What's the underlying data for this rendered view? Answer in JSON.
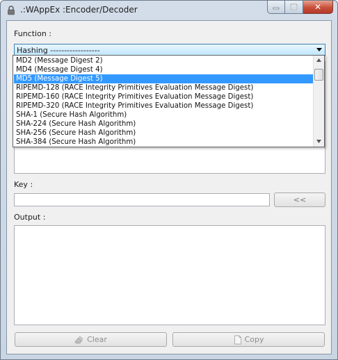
{
  "window": {
    "title": ".:WAppEx :Encoder/Decoder",
    "close_glyph": "✕"
  },
  "function": {
    "label": "Function :",
    "selected_value": "Hashing ------------------"
  },
  "dropdown": {
    "items": [
      "MD2 (Message Digest 2)",
      "MD4 (Message Digest 4)",
      "MD5 (Message Digest 5)",
      "RIPEMD-128 (RACE Integrity Primitives Evaluation Message Digest)",
      "RIPEMD-160 (RACE Integrity Primitives Evaluation Message Digest)",
      "RIPEMD-320 (RACE Integrity Primitives Evaluation Message Digest)",
      "SHA-1 (Secure Hash Algorithm)",
      "SHA-224 (Secure Hash Algorithm)",
      "SHA-256 (Secure Hash Algorithm)",
      "SHA-384 (Secure Hash Algorithm)"
    ],
    "selected_index": 2
  },
  "key": {
    "label": "Key :",
    "value": "",
    "apply_button": "<<"
  },
  "output": {
    "label": "Output :",
    "value": ""
  },
  "buttons": {
    "clear": "Clear",
    "copy": "Copy"
  },
  "colors": {
    "selection": "#3399ff",
    "combo_border": "#3c7fb1",
    "close_button": "#c8503a"
  },
  "icons": {
    "app": "lock-icon",
    "clear": "eraser-icon",
    "copy": "document-icon"
  }
}
